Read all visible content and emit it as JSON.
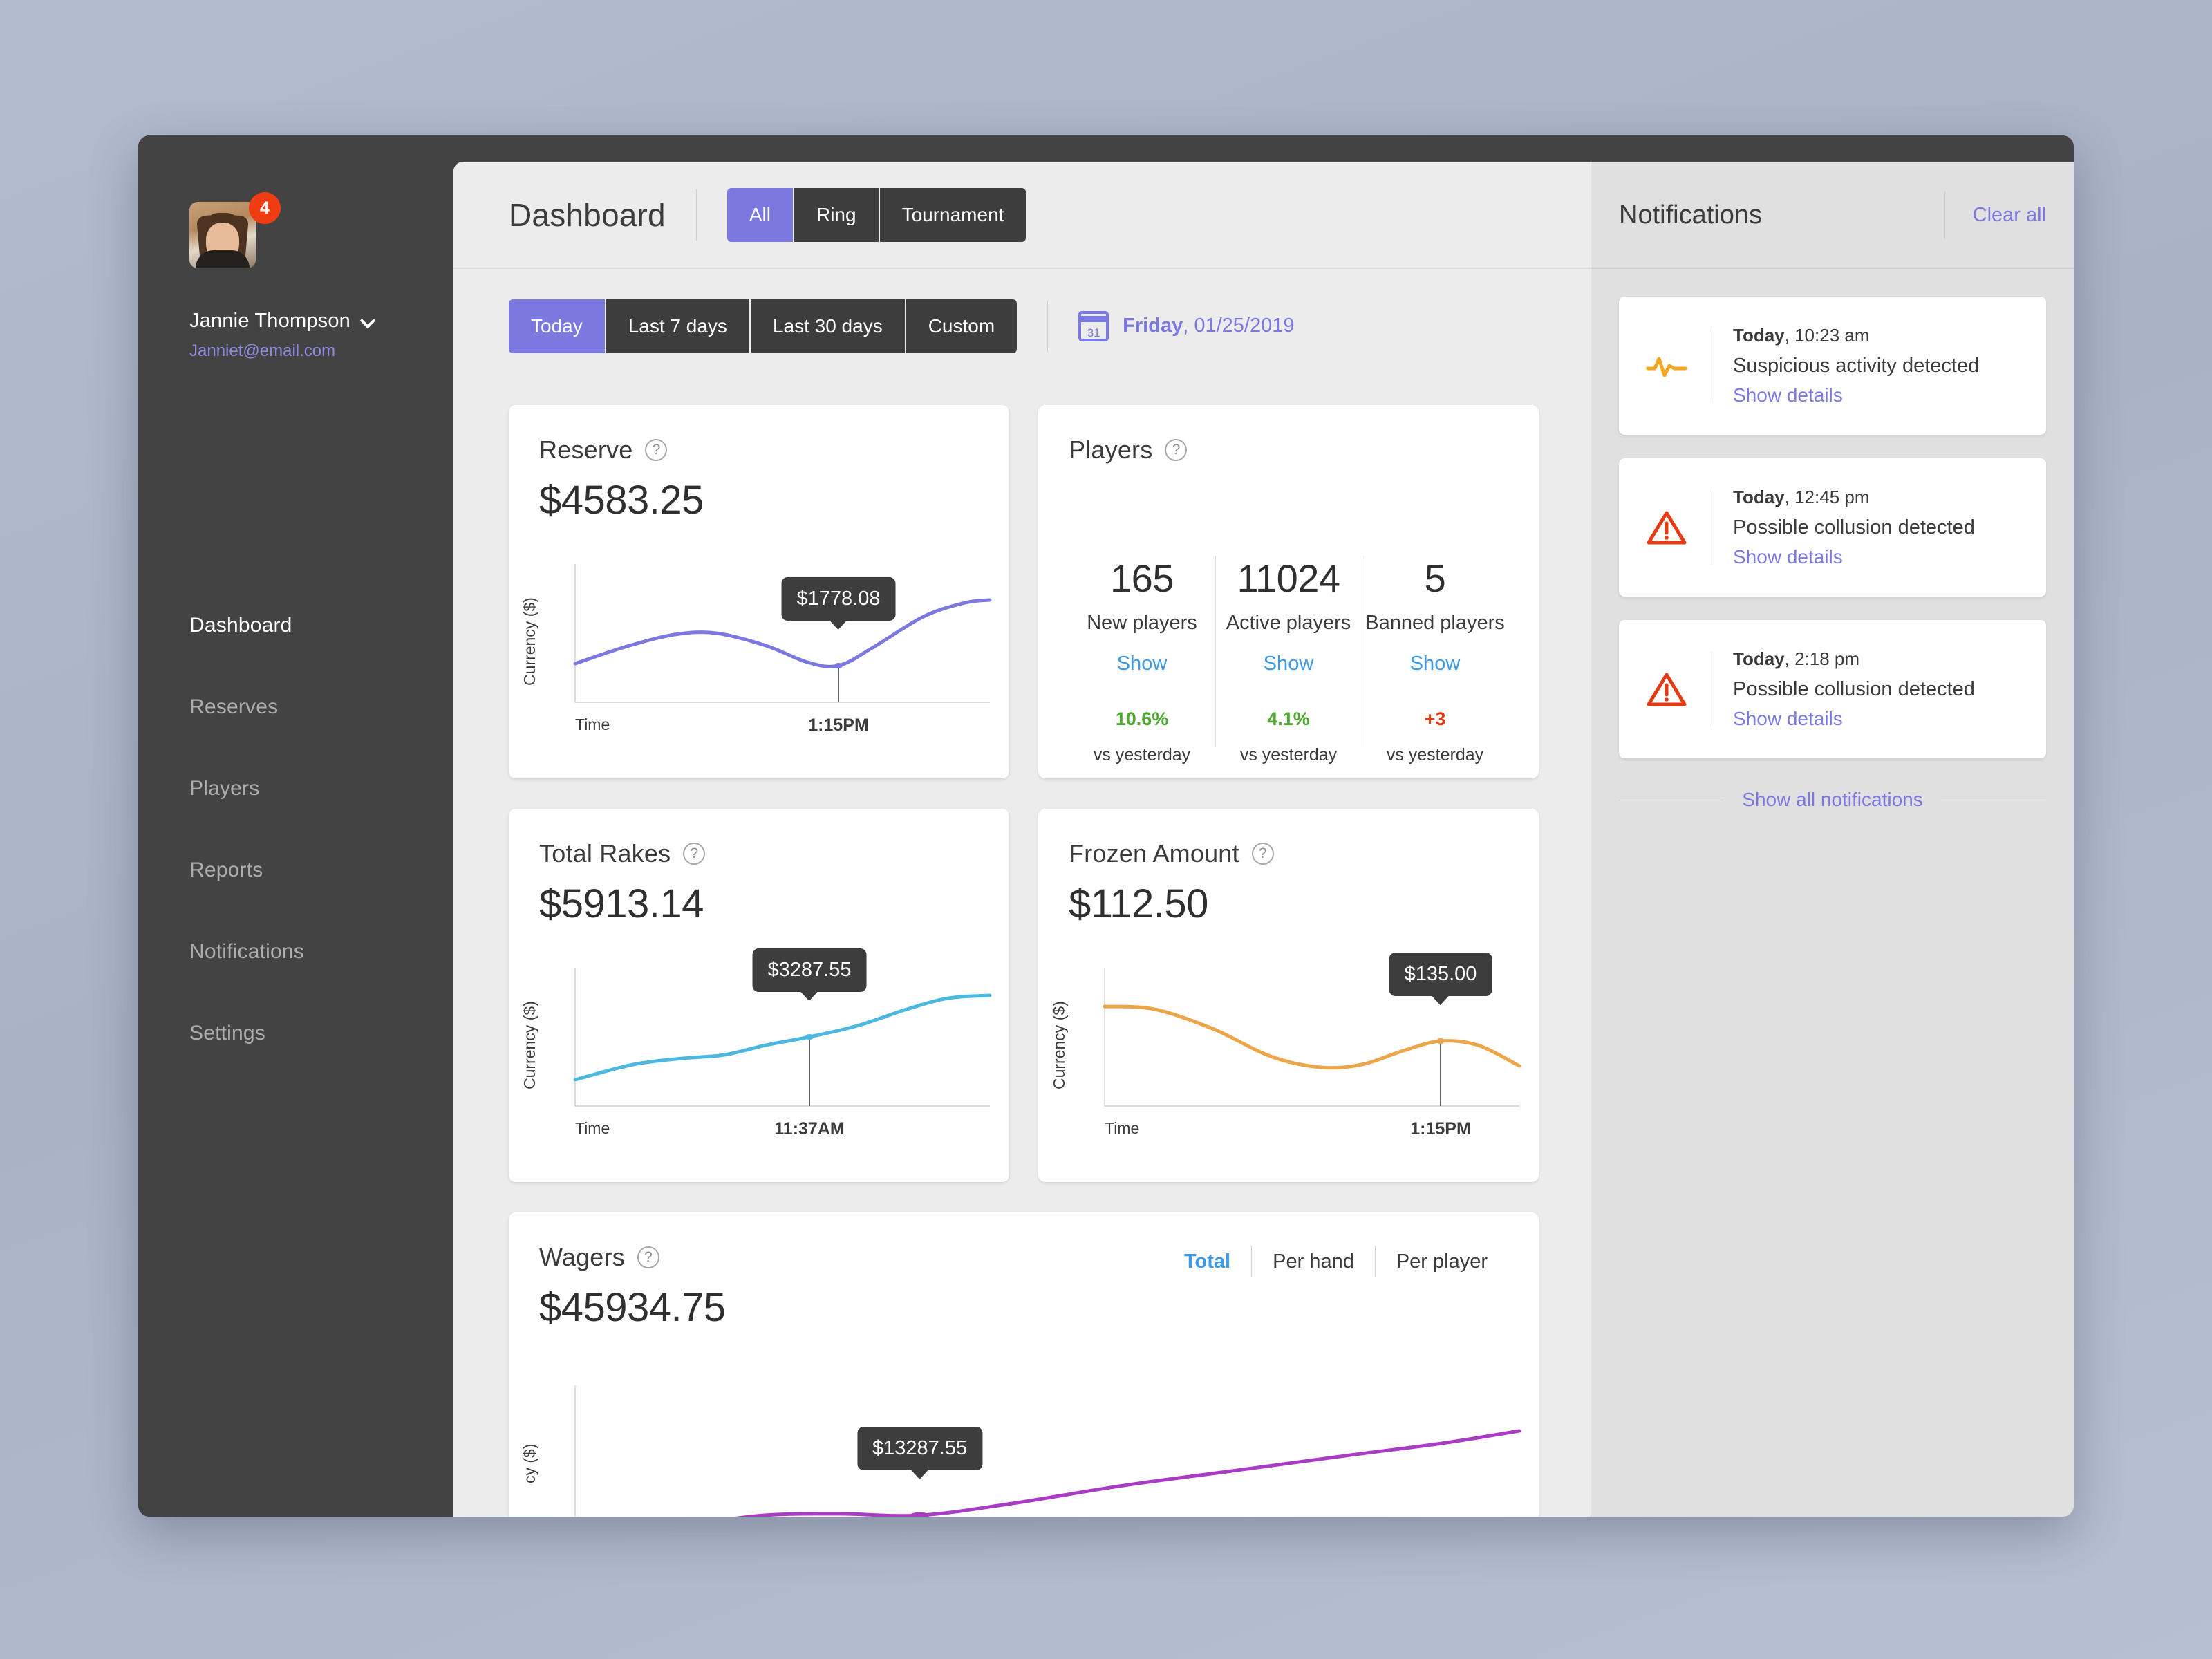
{
  "colors": {
    "accent_purple": "#7b79e0",
    "link_blue": "#3d9ae8",
    "positive_green": "#4ca82e",
    "negative_red": "#e63a12",
    "badge_red": "#f03c12",
    "reserve_line": "#7b79e0",
    "rakes_line": "#4cb8e0",
    "frozen_line": "#eda54a",
    "wagers_line": "#a93bc4",
    "sidebar_bg": "#434343",
    "tooltip_bg": "#3d3d3d"
  },
  "sidebar": {
    "badge_count": "4",
    "user_name": "Jannie Thompson",
    "user_email": "Janniet@email.com",
    "items": [
      {
        "label": "Dashboard",
        "active": true
      },
      {
        "label": "Reserves",
        "active": false
      },
      {
        "label": "Players",
        "active": false
      },
      {
        "label": "Reports",
        "active": false
      },
      {
        "label": "Notifications",
        "active": false
      },
      {
        "label": "Settings",
        "active": false
      }
    ]
  },
  "header": {
    "title": "Dashboard",
    "game_tabs": [
      {
        "label": "All",
        "active": true
      },
      {
        "label": "Ring",
        "active": false
      },
      {
        "label": "Tournament",
        "active": false
      }
    ]
  },
  "filters": {
    "range_tabs": [
      {
        "label": "Today",
        "active": true
      },
      {
        "label": "Last 7 days",
        "active": false
      },
      {
        "label": "Last 30 days",
        "active": false
      },
      {
        "label": "Custom",
        "active": false
      }
    ],
    "calendar_icon_day": "31",
    "date_day": "Friday",
    "date_value": ", 01/25/2019"
  },
  "cards": {
    "reserve": {
      "title": "Reserve",
      "value": "$4583.25",
      "ylabel": "Currency ($)",
      "xlabel_left": "Time",
      "xlabel_point": "1:15PM",
      "tooltip": "$1778.08"
    },
    "players": {
      "title": "Players",
      "columns": [
        {
          "number": "165",
          "label": "New players",
          "show": "Show",
          "delta": "10.6%",
          "vs": "vs yesterday",
          "direction": "up"
        },
        {
          "number": "11024",
          "label": "Active players",
          "show": "Show",
          "delta": "4.1%",
          "vs": "vs yesterday",
          "direction": "up"
        },
        {
          "number": "5",
          "label": "Banned players",
          "show": "Show",
          "delta": "+3",
          "vs": "vs yesterday",
          "direction": "down"
        }
      ]
    },
    "rakes": {
      "title": "Total Rakes",
      "value": "$5913.14",
      "ylabel": "Currency ($)",
      "xlabel_left": "Time",
      "xlabel_point": "11:37AM",
      "tooltip": "$3287.55"
    },
    "frozen": {
      "title": "Frozen Amount",
      "value": "$112.50",
      "ylabel": "Currency ($)",
      "xlabel_left": "Time",
      "xlabel_point": "1:15PM",
      "tooltip": "$135.00"
    },
    "wagers": {
      "title": "Wagers",
      "value": "$45934.75",
      "ylabel": "cy ($)",
      "tooltip": "$13287.55",
      "tabs": [
        {
          "label": "Total",
          "active": true
        },
        {
          "label": "Per hand",
          "active": false
        },
        {
          "label": "Per player",
          "active": false
        }
      ]
    }
  },
  "notifications": {
    "title": "Notifications",
    "clear_label": "Clear all",
    "show_all_label": "Show all notifications",
    "items": [
      {
        "time_day": "Today",
        "time_value": ", 10:23 am",
        "message": "Suspicious activity detected",
        "link": "Show details",
        "icon": "pulse"
      },
      {
        "time_day": "Today",
        "time_value": ", 12:45 pm",
        "message": "Possible collusion detected",
        "link": "Show details",
        "icon": "warning"
      },
      {
        "time_day": "Today",
        "time_value": ", 2:18 pm",
        "message": "Possible collusion detected",
        "link": "Show details",
        "icon": "warning"
      }
    ]
  },
  "chart_data": [
    {
      "id": "reserve",
      "type": "line",
      "title": "Reserve",
      "ylabel": "Currency ($)",
      "xlabel": "Time",
      "color": "#7b79e0",
      "marker": {
        "x": 0.635,
        "y": 0.265,
        "label": "$1778.08",
        "time": "1:15PM"
      },
      "points": [
        {
          "x": 0.0,
          "y": 0.28
        },
        {
          "x": 0.12,
          "y": 0.4
        },
        {
          "x": 0.24,
          "y": 0.49
        },
        {
          "x": 0.34,
          "y": 0.5
        },
        {
          "x": 0.46,
          "y": 0.41
        },
        {
          "x": 0.56,
          "y": 0.29
        },
        {
          "x": 0.635,
          "y": 0.265
        },
        {
          "x": 0.72,
          "y": 0.4
        },
        {
          "x": 0.84,
          "y": 0.62
        },
        {
          "x": 0.94,
          "y": 0.72
        },
        {
          "x": 1.0,
          "y": 0.74
        }
      ]
    },
    {
      "id": "total_rakes",
      "type": "line",
      "title": "Total Rakes",
      "ylabel": "Currency ($)",
      "xlabel": "Time",
      "color": "#4cb8e0",
      "marker": {
        "x": 0.565,
        "y": 0.5,
        "label": "$3287.55",
        "time": "11:37AM"
      },
      "points": [
        {
          "x": 0.0,
          "y": 0.19
        },
        {
          "x": 0.14,
          "y": 0.3
        },
        {
          "x": 0.26,
          "y": 0.345
        },
        {
          "x": 0.36,
          "y": 0.37
        },
        {
          "x": 0.46,
          "y": 0.44
        },
        {
          "x": 0.565,
          "y": 0.5
        },
        {
          "x": 0.68,
          "y": 0.58
        },
        {
          "x": 0.8,
          "y": 0.7
        },
        {
          "x": 0.9,
          "y": 0.78
        },
        {
          "x": 1.0,
          "y": 0.8
        }
      ]
    },
    {
      "id": "frozen_amount",
      "type": "line",
      "title": "Frozen Amount",
      "ylabel": "Currency ($)",
      "xlabel": "Time",
      "color": "#eda54a",
      "marker": {
        "x": 0.81,
        "y": 0.47,
        "label": "$135.00",
        "time": "1:15PM"
      },
      "points": [
        {
          "x": 0.0,
          "y": 0.72
        },
        {
          "x": 0.12,
          "y": 0.7
        },
        {
          "x": 0.26,
          "y": 0.56
        },
        {
          "x": 0.4,
          "y": 0.36
        },
        {
          "x": 0.52,
          "y": 0.28
        },
        {
          "x": 0.62,
          "y": 0.3
        },
        {
          "x": 0.72,
          "y": 0.4
        },
        {
          "x": 0.81,
          "y": 0.47
        },
        {
          "x": 0.9,
          "y": 0.44
        },
        {
          "x": 1.0,
          "y": 0.29
        }
      ]
    },
    {
      "id": "wagers",
      "type": "line",
      "title": "Wagers",
      "ylabel": "cy ($)",
      "color": "#a93bc4",
      "marker": {
        "x": 0.365,
        "y": 0.145,
        "label": "$13287.55"
      },
      "points": [
        {
          "x": 0.04,
          "y": 0.0
        },
        {
          "x": 0.12,
          "y": 0.08
        },
        {
          "x": 0.2,
          "y": 0.145
        },
        {
          "x": 0.28,
          "y": 0.155
        },
        {
          "x": 0.365,
          "y": 0.145
        },
        {
          "x": 0.46,
          "y": 0.22
        },
        {
          "x": 0.58,
          "y": 0.34
        },
        {
          "x": 0.7,
          "y": 0.44
        },
        {
          "x": 0.82,
          "y": 0.54
        },
        {
          "x": 0.92,
          "y": 0.62
        },
        {
          "x": 1.0,
          "y": 0.7
        }
      ]
    }
  ]
}
